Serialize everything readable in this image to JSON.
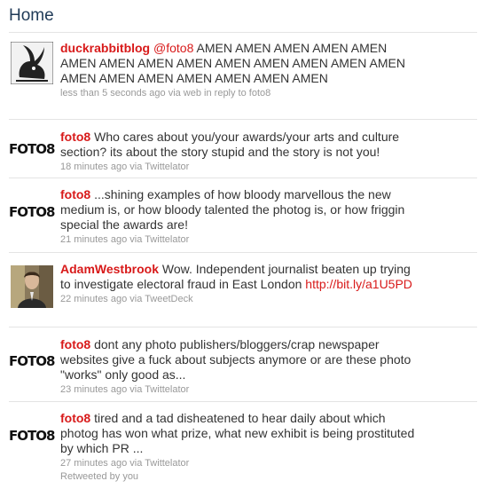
{
  "page": {
    "title": "Home"
  },
  "tweets": [
    {
      "author": "duckrabbitblog",
      "mention": "@foto8",
      "text": "AMEN AMEN AMEN AMEN AMEN AMEN AMEN AMEN AMEN AMEN AMEN AMEN AMEN AMEN AMEN AMEN AMEN AMEN AMEN AMEN AMEN",
      "meta": "less than 5 seconds ago via web in reply to foto8",
      "avatar": "duck-rabbit-drawing"
    },
    {
      "author": "foto8",
      "text": "Who cares about you/your awards/your arts and culture section? its about the story stupid and the story is not you!",
      "meta": "18 minutes ago via Twittelator",
      "avatar_text": "FOTO8"
    },
    {
      "author": "foto8",
      "text": "...shining examples of how bloody marvellous the new medium is, or how bloody talented the photog is, or how friggin special the awards are!",
      "meta": "21 minutes ago via Twittelator",
      "avatar_text": "FOTO8"
    },
    {
      "author": "AdamWestbrook",
      "text": "Wow. Independent journalist beaten up trying to investigate electoral fraud in East London",
      "link": "http://bit.ly/a1U5PD",
      "meta": "22 minutes ago via TweetDeck",
      "avatar": "person-photo"
    },
    {
      "author": "foto8",
      "text": "dont any photo publishers/bloggers/crap newspaper websites give a fuck about subjects anymore or are these photo \"works\" only good as...",
      "meta": "23 minutes ago via Twittelator",
      "avatar_text": "FOTO8"
    },
    {
      "author": "foto8",
      "text": "tired and a tad disheatened to hear daily about which photog has won what prize, what new exhibit is being prostituted by which PR ...",
      "meta": "27 minutes ago via Twittelator",
      "retweet": "Retweeted by you",
      "avatar_text": "FOTO8"
    }
  ]
}
